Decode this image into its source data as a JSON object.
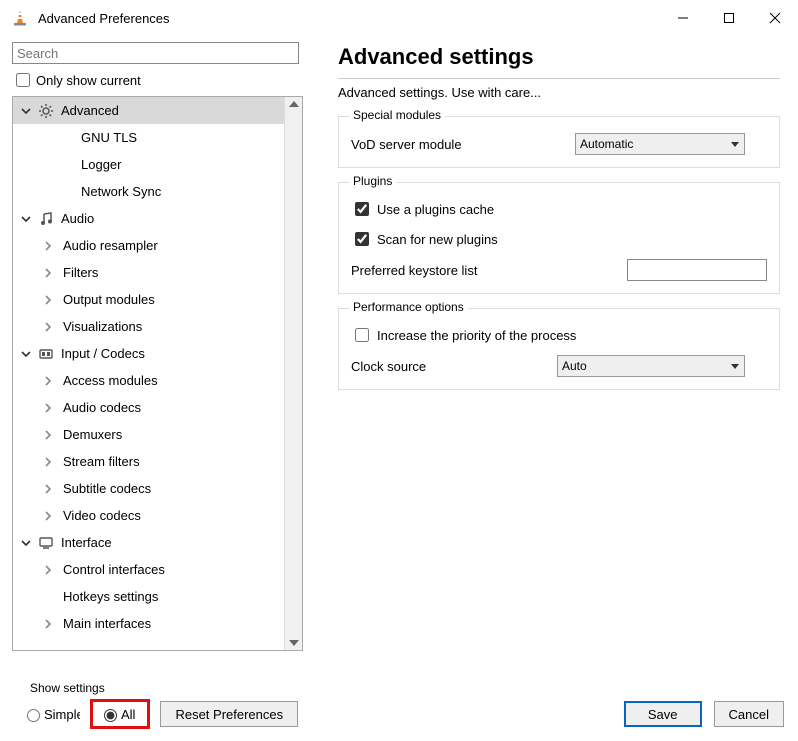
{
  "window": {
    "title": "Advanced Preferences"
  },
  "search": {
    "placeholder": "Search"
  },
  "only_current_label": "Only show current",
  "tree": [
    {
      "type": "top",
      "expanded": true,
      "selected": true,
      "icon": "gear",
      "label": "Advanced"
    },
    {
      "type": "leaf2",
      "label": "GNU TLS"
    },
    {
      "type": "leaf2",
      "label": "Logger"
    },
    {
      "type": "leaf2",
      "label": "Network Sync"
    },
    {
      "type": "top",
      "expanded": true,
      "icon": "music",
      "label": "Audio"
    },
    {
      "type": "leaf1",
      "arrow": true,
      "label": "Audio resampler"
    },
    {
      "type": "leaf1",
      "arrow": true,
      "label": "Filters"
    },
    {
      "type": "leaf1",
      "arrow": true,
      "label": "Output modules"
    },
    {
      "type": "leaf1",
      "arrow": true,
      "label": "Visualizations"
    },
    {
      "type": "top",
      "expanded": true,
      "icon": "codec",
      "label": "Input / Codecs"
    },
    {
      "type": "leaf1",
      "arrow": true,
      "label": "Access modules"
    },
    {
      "type": "leaf1",
      "arrow": true,
      "label": "Audio codecs"
    },
    {
      "type": "leaf1",
      "arrow": true,
      "label": "Demuxers"
    },
    {
      "type": "leaf1",
      "arrow": true,
      "label": "Stream filters"
    },
    {
      "type": "leaf1",
      "arrow": true,
      "label": "Subtitle codecs"
    },
    {
      "type": "leaf1",
      "arrow": true,
      "label": "Video codecs"
    },
    {
      "type": "top",
      "expanded": true,
      "icon": "interface",
      "label": "Interface"
    },
    {
      "type": "leaf1",
      "arrow": true,
      "label": "Control interfaces"
    },
    {
      "type": "leaf1",
      "arrow": false,
      "label": "Hotkeys settings"
    },
    {
      "type": "leaf1",
      "arrow": true,
      "label": "Main interfaces"
    }
  ],
  "page": {
    "title": "Advanced settings",
    "subtitle": "Advanced settings. Use with care...",
    "group_special": {
      "legend": "Special modules",
      "vod_label": "VoD server module",
      "vod_value": "Automatic"
    },
    "group_plugins": {
      "legend": "Plugins",
      "cache_label": "Use a plugins cache",
      "scan_label": "Scan for new plugins",
      "keystore_label": "Preferred keystore list"
    },
    "group_perf": {
      "legend": "Performance options",
      "priority_label": "Increase the priority of the process",
      "clock_label": "Clock source",
      "clock_value": "Auto"
    }
  },
  "bottom": {
    "show_settings": "Show settings",
    "simple": "Simple",
    "all": "All",
    "reset": "Reset Preferences",
    "save": "Save",
    "cancel": "Cancel"
  }
}
